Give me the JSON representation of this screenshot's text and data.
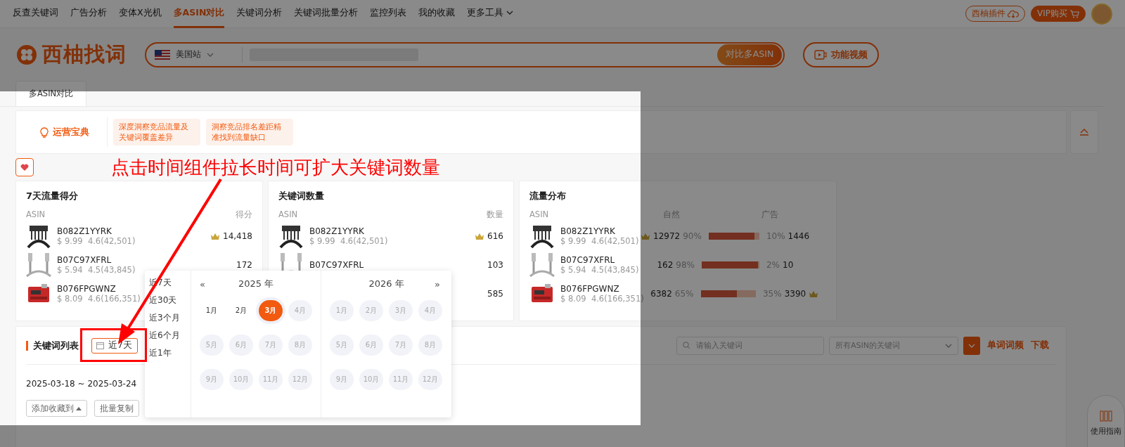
{
  "nav": {
    "items": [
      {
        "label": "反查关键词",
        "selected": false
      },
      {
        "label": "广告分析",
        "selected": false
      },
      {
        "label": "变体X光机",
        "selected": false
      },
      {
        "label": "多ASIN对比",
        "selected": true
      },
      {
        "label": "关键词分析",
        "selected": false
      },
      {
        "label": "关键词批量分析",
        "selected": false
      },
      {
        "label": "监控列表",
        "selected": false
      },
      {
        "label": "我的收藏",
        "selected": false
      },
      {
        "label": "更多工具",
        "selected": false
      }
    ],
    "plugin_button": "西柚插件",
    "vip_button": "VIP购买"
  },
  "header": {
    "logo_text": "西柚找词",
    "site_select": "美国站",
    "search_button": "对比多ASIN",
    "video_button": "功能视频"
  },
  "tabs": [
    {
      "label": "多ASIN对比",
      "selected": true
    }
  ],
  "tips": {
    "title": "运营宝典",
    "items": [
      "深度洞察竞品流量及关键词覆盖差异",
      "洞察竞品排名差距精准找到流量缺口"
    ]
  },
  "annotation": "点击时间组件拉长时间可扩大关键词数量",
  "cards": [
    {
      "kind": "value",
      "title": "7天流量得分",
      "column_1": "ASIN",
      "column_2": "得分",
      "rows": [
        {
          "asin": "B082Z1YYRK",
          "price": "$ 9.99",
          "rating": "4.6(42,501)",
          "value": "14,418",
          "top": true
        },
        {
          "asin": "B07C97XFRL",
          "price": "$ 5.94",
          "rating": "4.5(43,845)",
          "value": "172",
          "top": false
        },
        {
          "asin": "B076FPGWNZ",
          "price": "$ 8.09",
          "rating": "4.6(166,351)"
        }
      ]
    },
    {
      "kind": "value",
      "title": "关键词数量",
      "column_1": "ASIN",
      "column_2": "数量",
      "rows": [
        {
          "asin": "B082Z1YYRK",
          "price": "$ 9.99",
          "rating": "4.6(42,501)",
          "value": "616",
          "top": true
        },
        {
          "asin": "B07C97XFRL",
          "price": "",
          "rating": "",
          "value": "103",
          "top": false
        },
        {
          "asin": "",
          "price": "",
          "rating": "",
          "value": "585",
          "top": false
        }
      ]
    },
    {
      "kind": "distribution",
      "title": "流量分布",
      "column_1": "ASIN",
      "column_2": "自然",
      "column_3": "广告",
      "rows": [
        {
          "asin": "B082Z1YYRK",
          "price": "$ 9.99",
          "rating": "4.6(42,501)",
          "organic": "12972",
          "organic_pct": "90%",
          "level": 0.9,
          "ad_pct": "10%",
          "ad": "1446",
          "organic_top": true,
          "ad_top": false
        },
        {
          "asin": "B07C97XFRL",
          "price": "$ 5.94",
          "rating": "4.5(43,845)",
          "organic": "162",
          "organic_pct": "98%",
          "level": 0.98,
          "ad_pct": "2%",
          "ad": "10",
          "organic_top": false,
          "ad_top": false
        },
        {
          "asin": "B076FPGWNZ",
          "price": "$ 8.09",
          "rating": "4.6(166,351)",
          "organic": "6382",
          "organic_pct": "65%",
          "level": 0.65,
          "ad_pct": "35%",
          "ad": "3390",
          "organic_top": false,
          "ad_top": true
        }
      ]
    }
  ],
  "keyword_list": {
    "title": "关键词列表",
    "date_button": "近7天",
    "date_range": "2025-03-18 ~ 2025-03-24",
    "buttons": [
      "添加收藏到",
      "批量复制"
    ],
    "search_placeholder": "请输入关键词",
    "filter_select": "所有ASIN的关键词",
    "links": [
      "单词词频",
      "下载"
    ]
  },
  "calendar": {
    "presets": [
      "近7天",
      "近30天",
      "近3个月",
      "近6个月",
      "近1年"
    ],
    "prev": "«",
    "next": "»",
    "years": [
      {
        "label": "2025 年",
        "months": [
          {
            "label": "1月",
            "selected": false,
            "disabled": false
          },
          {
            "label": "2月",
            "selected": false,
            "disabled": false
          },
          {
            "label": "3月",
            "selected": true,
            "disabled": false
          },
          {
            "label": "4月",
            "selected": false,
            "disabled": true
          },
          {
            "label": "5月",
            "selected": false,
            "disabled": true
          },
          {
            "label": "6月",
            "selected": false,
            "disabled": true
          },
          {
            "label": "7月",
            "selected": false,
            "disabled": true
          },
          {
            "label": "8月",
            "selected": false,
            "disabled": true
          },
          {
            "label": "9月",
            "selected": false,
            "disabled": true
          },
          {
            "label": "10月",
            "selected": false,
            "disabled": true
          },
          {
            "label": "11月",
            "selected": false,
            "disabled": true
          },
          {
            "label": "12月",
            "selected": false,
            "disabled": true
          }
        ]
      },
      {
        "label": "2026 年",
        "months": [
          {
            "label": "1月",
            "selected": false,
            "disabled": true
          },
          {
            "label": "2月",
            "selected": false,
            "disabled": true
          },
          {
            "label": "3月",
            "selected": false,
            "disabled": true
          },
          {
            "label": "4月",
            "selected": false,
            "disabled": true
          },
          {
            "label": "5月",
            "selected": false,
            "disabled": true
          },
          {
            "label": "6月",
            "selected": false,
            "disabled": true
          },
          {
            "label": "7月",
            "selected": false,
            "disabled": true
          },
          {
            "label": "8月",
            "selected": false,
            "disabled": true
          },
          {
            "label": "9月",
            "selected": false,
            "disabled": true
          },
          {
            "label": "10月",
            "selected": false,
            "disabled": true
          },
          {
            "label": "11月",
            "selected": false,
            "disabled": true
          },
          {
            "label": "12月",
            "selected": false,
            "disabled": true
          }
        ]
      }
    ]
  },
  "guide": "使用指南"
}
